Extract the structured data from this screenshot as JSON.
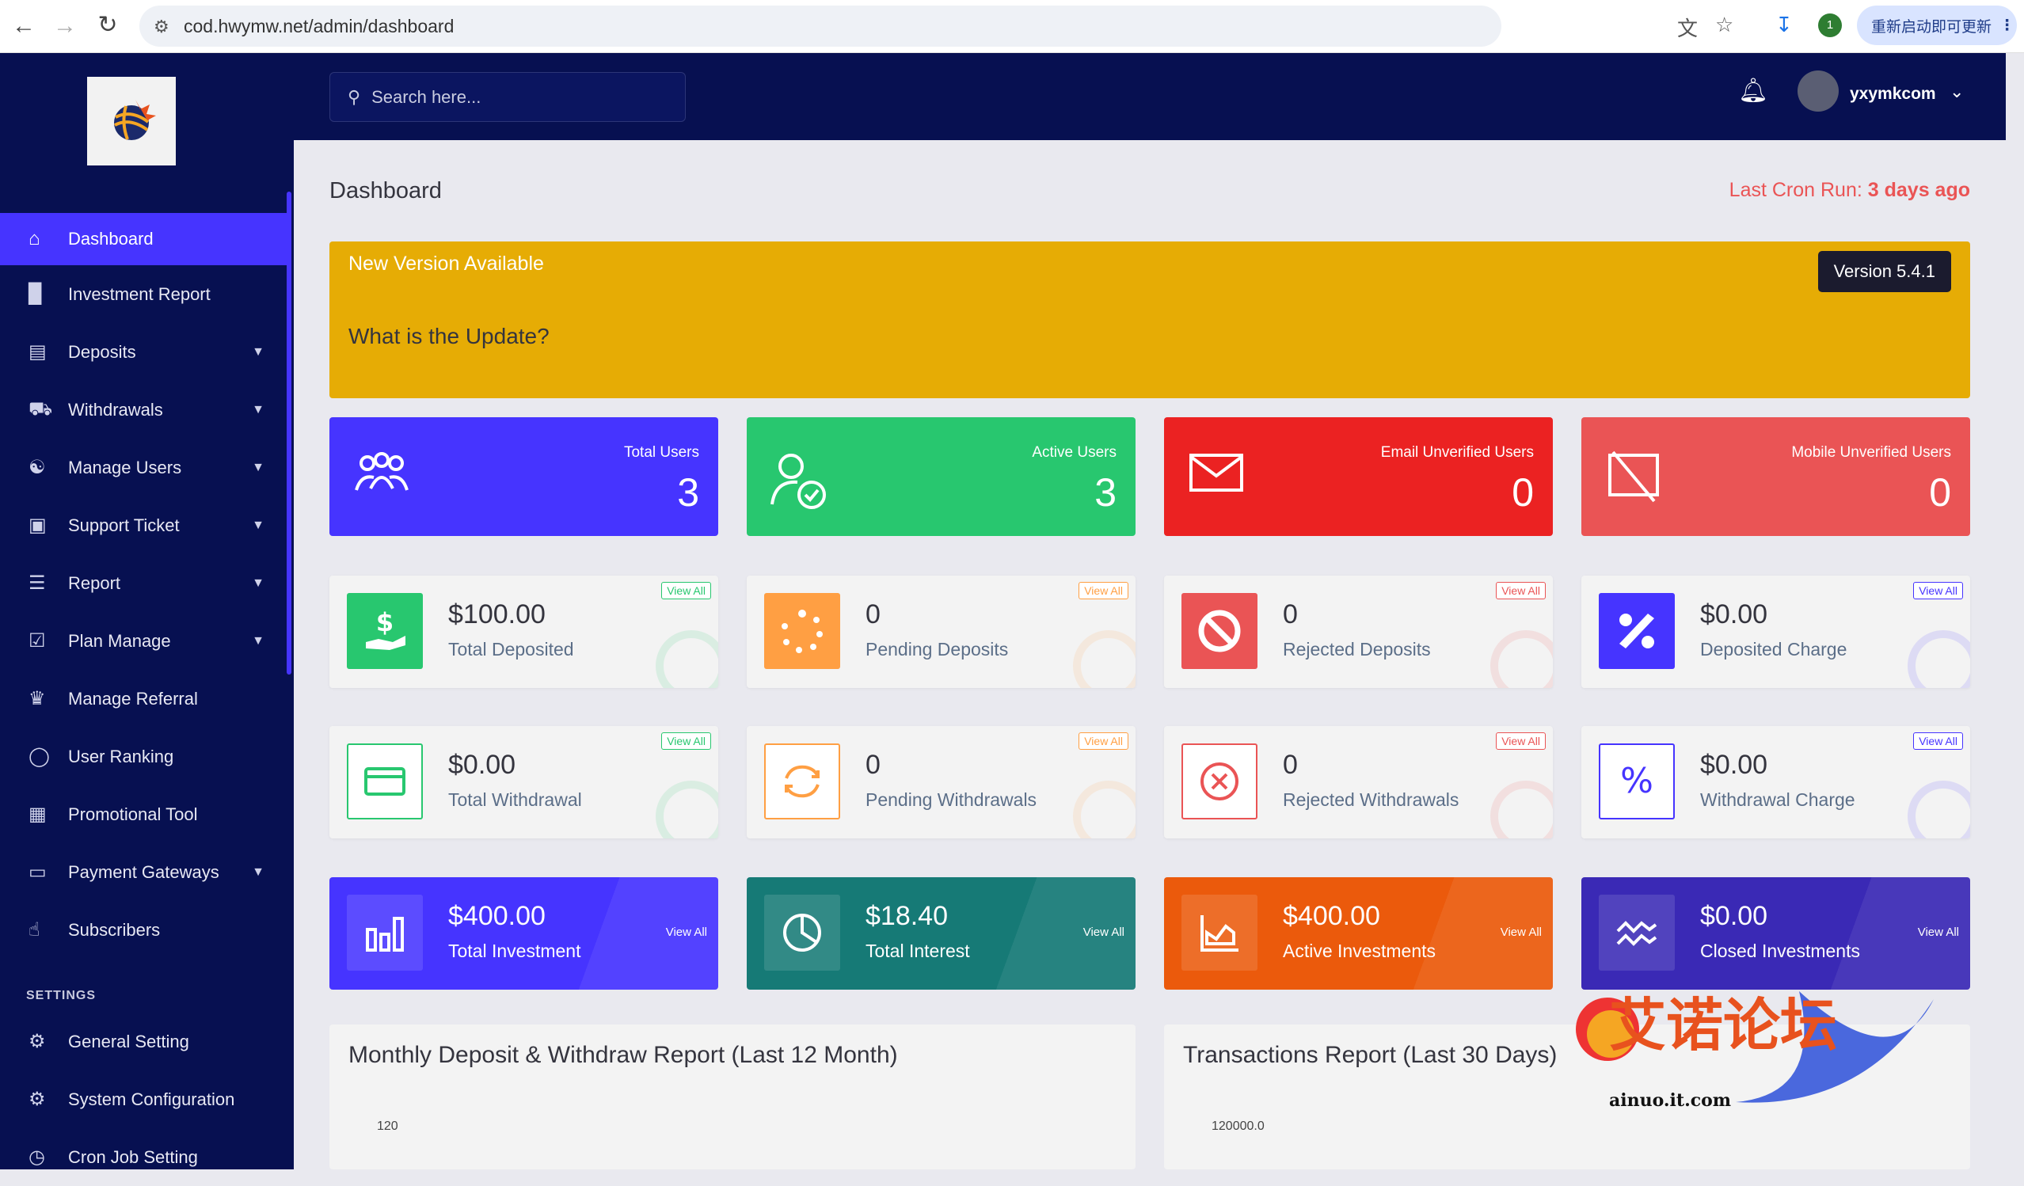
{
  "browser": {
    "url": "cod.hwymw.net/admin/dashboard",
    "extension_badge": "1",
    "update_label": "重新启动即可更新"
  },
  "sidebar": {
    "items": [
      {
        "label": "Dashboard",
        "icon": "home-icon",
        "active": true
      },
      {
        "label": "Investment Report",
        "icon": "bar-chart-icon"
      },
      {
        "label": "Deposits",
        "icon": "receipt-icon",
        "caret": true
      },
      {
        "label": "Withdrawals",
        "icon": "bank-icon",
        "caret": true
      },
      {
        "label": "Manage Users",
        "icon": "users-icon",
        "caret": true
      },
      {
        "label": "Support Ticket",
        "icon": "ticket-icon",
        "caret": true
      },
      {
        "label": "Report",
        "icon": "list-icon",
        "caret": true
      },
      {
        "label": "Plan Manage",
        "icon": "clipboard-icon",
        "caret": true
      },
      {
        "label": "Manage Referral",
        "icon": "referral-icon"
      },
      {
        "label": "User Ranking",
        "icon": "medal-icon"
      },
      {
        "label": "Promotional Tool",
        "icon": "image-icon"
      },
      {
        "label": "Payment Gateways",
        "icon": "credit-card-icon",
        "caret": true
      },
      {
        "label": "Subscribers",
        "icon": "thumbs-up-icon"
      }
    ],
    "settings_heading": "SETTINGS",
    "settings_items": [
      {
        "label": "General Setting",
        "icon": "gear-icon"
      },
      {
        "label": "System Configuration",
        "icon": "cog-icon"
      },
      {
        "label": "Cron Job Setting",
        "icon": "clock-icon"
      }
    ]
  },
  "header": {
    "search_placeholder": "Search here...",
    "username": "yxymkcom"
  },
  "page": {
    "title": "Dashboard",
    "cron_label": "Last Cron Run:",
    "cron_value": "3 days ago"
  },
  "banner": {
    "heading": "New Version Available",
    "question": "What is the Update?",
    "version": "Version 5.4.1"
  },
  "users_widgets": [
    {
      "label": "Total Users",
      "value": "3",
      "color": "#4634ff",
      "icon": "users-group-icon"
    },
    {
      "label": "Active Users",
      "value": "3",
      "color": "#28c76f",
      "icon": "user-check-icon"
    },
    {
      "label": "Email Unverified Users",
      "value": "0",
      "color": "#eb2222",
      "icon": "envelope-icon"
    },
    {
      "label": "Mobile Unverified Users",
      "value": "0",
      "color": "#ea5455",
      "icon": "mobile-slash-icon"
    }
  ],
  "deposit_widgets": [
    {
      "amount": "$100.00",
      "caption": "Total Deposited",
      "color": "#28c76f",
      "icon": "hand-dollar-icon",
      "view_all": "View All"
    },
    {
      "amount": "0",
      "caption": "Pending Deposits",
      "color": "#ff9f43",
      "icon": "spinner-icon",
      "view_all": "View All"
    },
    {
      "amount": "0",
      "caption": "Rejected Deposits",
      "color": "#ea5455",
      "icon": "ban-icon",
      "view_all": "View All"
    },
    {
      "amount": "$0.00",
      "caption": "Deposited Charge",
      "color": "#4634ff",
      "icon": "percent-icon",
      "view_all": "View All"
    }
  ],
  "withdraw_widgets": [
    {
      "amount": "$0.00",
      "caption": "Total Withdrawal",
      "color": "#28c76f",
      "icon": "wallet-card-icon",
      "view_all": "View All"
    },
    {
      "amount": "0",
      "caption": "Pending Withdrawals",
      "color": "#ff9f43",
      "icon": "sync-icon",
      "view_all": "View All"
    },
    {
      "amount": "0",
      "caption": "Rejected Withdrawals",
      "color": "#ea5455",
      "icon": "times-circle-icon",
      "view_all": "View All"
    },
    {
      "amount": "$0.00",
      "caption": "Withdrawal Charge",
      "color": "#4634ff",
      "icon": "percent-icon",
      "view_all": "View All"
    }
  ],
  "investment_widgets": [
    {
      "amount": "$400.00",
      "caption": "Total Investment",
      "color": "#4634ff",
      "icon": "chart-bars-icon",
      "view_all": "View All"
    },
    {
      "amount": "$18.40",
      "caption": "Total Interest",
      "color": "#167a76",
      "icon": "pie-chart-icon",
      "view_all": "View All"
    },
    {
      "amount": "$400.00",
      "caption": "Active Investments",
      "color": "#eb5a0c",
      "icon": "chart-area-icon",
      "view_all": "View All"
    },
    {
      "amount": "$0.00",
      "caption": "Closed Investments",
      "color": "#3a29b5",
      "icon": "wave-icon",
      "view_all": "View All"
    }
  ],
  "charts": [
    {
      "title": "Monthly Deposit & Withdraw Report (Last 12 Month)",
      "first_tick": "120"
    },
    {
      "title": "Transactions Report (Last 30 Days)",
      "first_tick": "120000.0"
    }
  ],
  "watermark": {
    "text": "艾诺论坛",
    "site": "ainuo.it.com"
  }
}
